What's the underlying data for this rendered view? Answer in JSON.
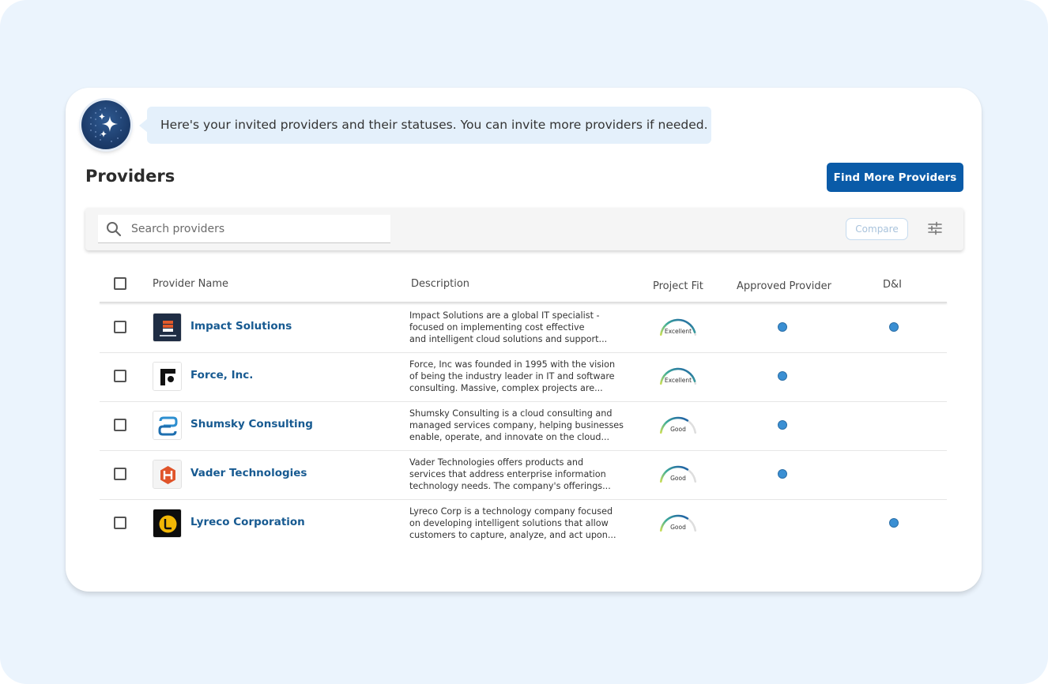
{
  "assistant": {
    "message": "Here's your invited providers and their statuses. You can invite more providers if needed."
  },
  "page": {
    "title": "Providers",
    "find_more_label": "Find More Providers"
  },
  "toolbar": {
    "search_placeholder": "Search providers",
    "compare_label": "Compare"
  },
  "table": {
    "columns": {
      "name": "Provider Name",
      "description": "Description",
      "fit": "Project Fit",
      "approved": "Approved Provider",
      "dni": "D&I"
    },
    "rows": [
      {
        "name": "Impact Solutions",
        "desc": [
          "Impact Solutions are a global IT specialist -",
          "focused on implementing cost effective",
          "and intelligent cloud solutions and support..."
        ],
        "fit": "Excellent",
        "fit_level": 0.95,
        "approved": true,
        "dni": true,
        "logo": "impact-logo"
      },
      {
        "name": "Force, Inc.",
        "desc": [
          "Force, Inc was founded in 1995 with the vision",
          "of being the industry leader in IT and software",
          "consulting. Massive, complex projects are..."
        ],
        "fit": "Excellent",
        "fit_level": 0.95,
        "approved": true,
        "dni": false,
        "logo": "force-logo"
      },
      {
        "name": "Shumsky Consulting",
        "desc": [
          "Shumsky Consulting is a cloud consulting and",
          "managed services company, helping businesses",
          "enable, operate, and innovate on the cloud..."
        ],
        "fit": "Good",
        "fit_level": 0.7,
        "approved": true,
        "dni": false,
        "logo": "shumsky-logo"
      },
      {
        "name": "Vader Technologies",
        "desc": [
          "Vader Technologies offers products and",
          "services that address enterprise information",
          "technology needs. The company's offerings..."
        ],
        "fit": "Good",
        "fit_level": 0.7,
        "approved": true,
        "dni": false,
        "logo": "vader-logo"
      },
      {
        "name": "Lyreco Corporation",
        "desc": [
          "Lyreco Corp is a technology company focused",
          "on developing intelligent solutions that allow",
          "customers to capture, analyze, and act upon..."
        ],
        "fit": "Good",
        "fit_level": 0.7,
        "approved": false,
        "dni": true,
        "logo": "lyreco-logo"
      }
    ]
  },
  "colors": {
    "accent": "#0a5ba8",
    "link": "#175a91",
    "dot": "#3a8fd3",
    "background": "#ebf4fd"
  },
  "icons": [
    "sparkle-icon",
    "search-icon",
    "filter-sliders-icon"
  ]
}
